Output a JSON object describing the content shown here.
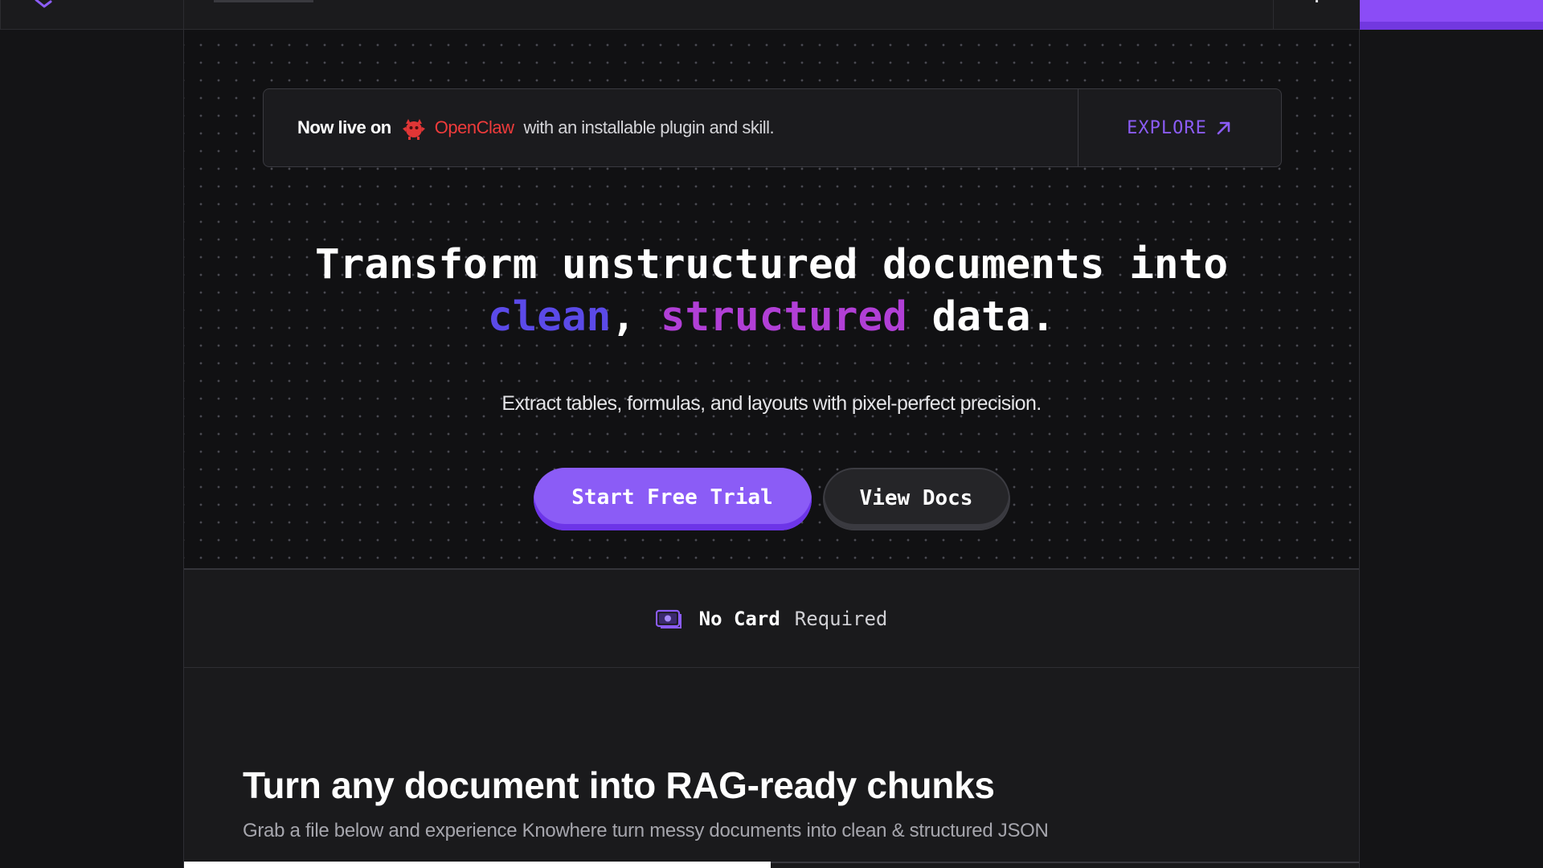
{
  "topbar": {
    "logo_icon": "knowhere-logo-icon",
    "cta_color": "#8b4cf6"
  },
  "banner": {
    "prefix": "Now live on",
    "brand_icon": "claw-icon",
    "brand": "OpenClaw",
    "suffix": "with an installable plugin and skill.",
    "explore_label": "EXPLORE",
    "explore_icon": "arrow-up-right-icon"
  },
  "hero": {
    "headline_line1": "Transform unstructured documents into",
    "headline_clean": "clean",
    "headline_comma": ",",
    "headline_structured": "structured",
    "headline_end": "data.",
    "subheadline": "Extract tables, formulas, and layouts with pixel-perfect precision.",
    "primary_button": "Start Free Trial",
    "secondary_button": "View Docs"
  },
  "no_card": {
    "icon": "money-bill-icon",
    "strong": "No Card",
    "rest": "Required"
  },
  "rag": {
    "title": "Turn any document into RAG-ready chunks",
    "description": "Grab a file below and experience Knowhere turn messy documents into clean & structured JSON"
  },
  "colors": {
    "accent": "#8b5cf6",
    "brand_red": "#ef3b3b",
    "clean_blue": "#5b4ae8",
    "structured_magenta": "#b13fd6",
    "background": "#141416"
  }
}
